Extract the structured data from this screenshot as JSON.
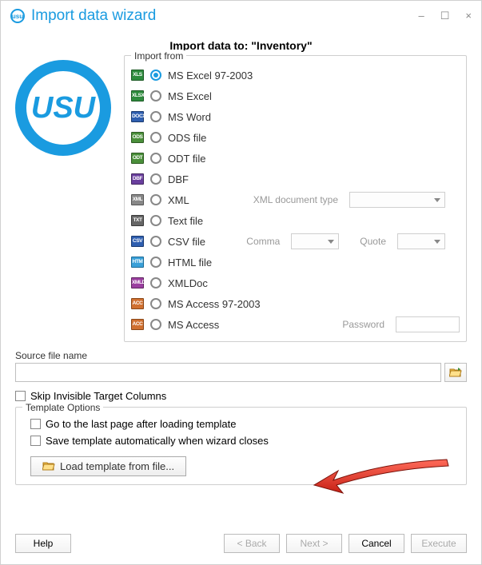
{
  "window": {
    "title": "Import data wizard"
  },
  "page_title": "Import data to: \"Inventory\"",
  "import_from": {
    "legend": "Import from",
    "selected_index": 0,
    "options": [
      {
        "label": "MS Excel 97-2003",
        "tag": "XLS",
        "bg": "#2e8b3d",
        "border": "#1c5a25"
      },
      {
        "label": "MS Excel",
        "tag": "XLSX",
        "bg": "#2e8b3d",
        "border": "#1c5a25"
      },
      {
        "label": "MS Word",
        "tag": "DOCX",
        "bg": "#2f5fb0",
        "border": "#1c3b70"
      },
      {
        "label": "ODS file",
        "tag": "ODS",
        "bg": "#4a8f3a",
        "border": "#2e5a23"
      },
      {
        "label": "ODT file",
        "tag": "ODT",
        "bg": "#4a8f3a",
        "border": "#2e5a23"
      },
      {
        "label": "DBF",
        "tag": "DBF",
        "bg": "#6a3f9e",
        "border": "#432760"
      },
      {
        "label": "XML",
        "tag": "XML",
        "bg": "#888888",
        "border": "#555555",
        "extras": [
          {
            "type": "label",
            "text": "XML document type"
          },
          {
            "type": "select",
            "wide": true
          }
        ]
      },
      {
        "label": "Text file",
        "tag": "TXT",
        "bg": "#666666",
        "border": "#3a3a3a"
      },
      {
        "label": "CSV file",
        "tag": "CSV",
        "bg": "#2f5fb0",
        "border": "#1c3b70",
        "extras": [
          {
            "type": "label",
            "text": "Comma"
          },
          {
            "type": "select"
          },
          {
            "type": "label",
            "text": "Quote"
          },
          {
            "type": "select"
          }
        ]
      },
      {
        "label": "HTML file",
        "tag": "HTM",
        "bg": "#3aa0d8",
        "border": "#1d6c97"
      },
      {
        "label": "XMLDoc",
        "tag": "XMLD",
        "bg": "#9b3fa0",
        "border": "#5f265f"
      },
      {
        "label": "MS Access 97-2003",
        "tag": "ACC",
        "bg": "#d07030",
        "border": "#8a4718"
      },
      {
        "label": "MS Access",
        "tag": "ACC",
        "bg": "#d07030",
        "border": "#8a4718",
        "extras": [
          {
            "type": "label",
            "text": "Password"
          },
          {
            "type": "input"
          }
        ]
      }
    ]
  },
  "source": {
    "label": "Source file name",
    "value": ""
  },
  "skip_invisible": {
    "label": "Skip Invisible Target Columns",
    "checked": false
  },
  "template": {
    "legend": "Template Options",
    "opt1": {
      "label": "Go to the last page after loading template",
      "checked": false
    },
    "opt2": {
      "label": "Save template automatically when wizard closes",
      "checked": false
    },
    "load_btn": "Load template from file..."
  },
  "buttons": {
    "help": "Help",
    "back": "< Back",
    "next": "Next >",
    "cancel": "Cancel",
    "execute": "Execute"
  }
}
